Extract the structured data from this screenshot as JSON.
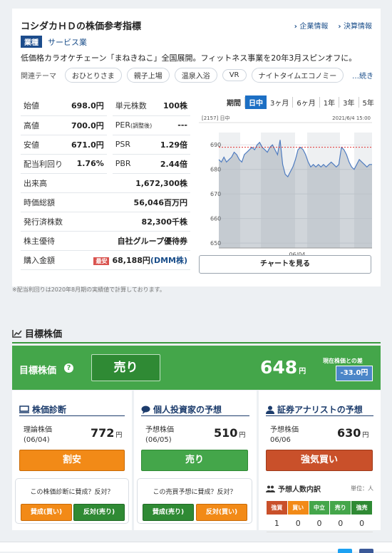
{
  "header": {
    "title": "コシダカＨＤの株価参考指標",
    "link_company": "企業情報",
    "link_finance": "決算情報"
  },
  "sector": {
    "tag": "業種",
    "value": "サービス業"
  },
  "description": "低価格カラオケチェーン「まねきねこ」全国展開。フィットネス事業を20年3月スピンオフに。",
  "themes": {
    "label": "関連テーマ",
    "items": [
      "おひとりさま",
      "親子上場",
      "温泉入浴",
      "VR",
      "ナイトタイムエコノミー"
    ],
    "more": "…続き"
  },
  "stats": {
    "open": {
      "k": "始値",
      "v": "698.0円"
    },
    "high": {
      "k": "高値",
      "v": "700.0円"
    },
    "low": {
      "k": "安値",
      "v": "671.0円"
    },
    "yield": {
      "k": "配当利回り",
      "v": "1.76%"
    },
    "unit": {
      "k": "単元株数",
      "v": "100株"
    },
    "per": {
      "k": "PER",
      "ks": "(調整後)",
      "v": "---"
    },
    "psr": {
      "k": "PSR",
      "v": "1.29倍"
    },
    "pbr": {
      "k": "PBR",
      "v": "2.44倍"
    },
    "volume": {
      "k": "出来高",
      "v": "1,672,300株"
    },
    "mcap": {
      "k": "時価総額",
      "v": "56,046百万円"
    },
    "shares": {
      "k": "発行済株数",
      "v": "82,300千株"
    },
    "benefit": {
      "k": "株主優待",
      "v": "自社グループ優待券"
    },
    "buy": {
      "k": "購入金額",
      "badge": "最安",
      "v": "68,188円",
      "dmm": "(DMM株)"
    }
  },
  "periods": [
    "期間",
    "日中",
    "3ヶ月",
    "6ヶ月",
    "1年",
    "3年",
    "5年"
  ],
  "chart_data": {
    "type": "area",
    "code_label": "[2157] 日中",
    "datetime": "2021/6/4 15:00",
    "yticks": [
      650,
      660,
      670,
      680,
      690
    ],
    "ylim": [
      648,
      695
    ],
    "xtick": "06/04",
    "ref_line": 689,
    "values": [
      684,
      683,
      685,
      683,
      684,
      685,
      687,
      686,
      684,
      683,
      686,
      687,
      688,
      689,
      688,
      690,
      691,
      689,
      688,
      687,
      689,
      690,
      688,
      686,
      692,
      682,
      678,
      677,
      679,
      681,
      684,
      688,
      689,
      688,
      686,
      683,
      681,
      682,
      681,
      682,
      681,
      682,
      681,
      682,
      683,
      682,
      681,
      682,
      689,
      688,
      686,
      683,
      681,
      680,
      682,
      684,
      683,
      682,
      681,
      682,
      682
    ]
  },
  "chart_button": "チャートを見る",
  "note": "※配当利回りは2020年8月期の実績値で計算しております。",
  "target": {
    "section": "目標株価",
    "label": "目標株価",
    "help": "?",
    "verdict": "売り",
    "price": "648",
    "unit": "円",
    "diff_label": "現在株価との差",
    "diff": "-33.0円"
  },
  "diag": {
    "title": "株価診断",
    "sub1": "理論株価",
    "sub2": "(06/04)",
    "price": "772",
    "unit": "円",
    "verdict": "割安",
    "question": "この株価診断に賛成？反対？",
    "agree": "賛成(買い)",
    "disagree": "反対(売り)"
  },
  "indiv": {
    "title": "個人投資家の予想",
    "sub1": "予想株価",
    "sub2": "(06/05)",
    "price": "510",
    "unit": "円",
    "verdict": "売り",
    "question": "この売買予想に賛成？反対？",
    "agree": "賛成(売り)",
    "disagree": "反対(買い)"
  },
  "analyst": {
    "title": "証券アナリストの予想",
    "sub1": "予想株価",
    "sub2": "06/06",
    "price": "630",
    "unit": "円",
    "verdict": "強気買い",
    "breakdown_title": "予想人数内訳",
    "unit_label": "単位：人",
    "headers": [
      "強買",
      "買い",
      "中立",
      "売り",
      "強売"
    ],
    "header_colors": [
      "#c9502a",
      "#f28a17",
      "#44a64a",
      "#44a64a",
      "#2f8a34"
    ],
    "counts": [
      "1",
      "0",
      "0",
      "0",
      "0"
    ]
  }
}
